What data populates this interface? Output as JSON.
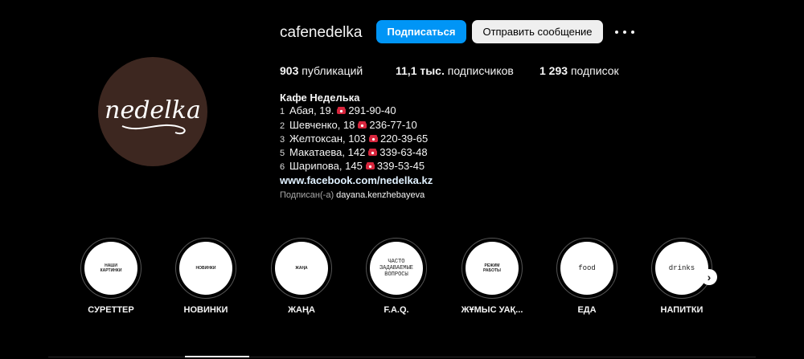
{
  "profile": {
    "username": "cafenedelka",
    "follow_label": "Подписаться",
    "message_label": "Отправить сообщение",
    "more_icon": "more-horizontal-icon",
    "avatar_text": "nedelka",
    "avatar_bg": "#3d2720"
  },
  "stats": {
    "posts_count": "903",
    "posts_label": "публикаций",
    "followers_count": "11,1 тыс.",
    "followers_label": "подписчиков",
    "following_count": "1 293",
    "following_label": "подписок"
  },
  "bio": {
    "name": "Кафе Неделька",
    "lines": [
      {
        "num": "1",
        "address": "Абая, 19.",
        "phone": "291-90-40"
      },
      {
        "num": "2",
        "address": "Шевченко, 18",
        "phone": "236-77-10"
      },
      {
        "num": "3",
        "address": "Желтоксан, 103",
        "phone": "220-39-65"
      },
      {
        "num": "5",
        "address": "Макатаева, 142",
        "phone": "339-63-48"
      },
      {
        "num": "6",
        "address": "Шарипова, 145",
        "phone": "339-53-45"
      }
    ],
    "phone_icon": "telephone-icon",
    "link": "www.facebook.com/nedelka.kz",
    "followed_by_prefix": "Подписан(-а)",
    "followed_by_user": "dayana.kenzhebayeva"
  },
  "highlights": [
    {
      "cover": "НАШИ\nКАРТИНКИ",
      "label": "СУРЕТТЕР"
    },
    {
      "cover": "НОВИНКИ",
      "label": "НОВИНКИ"
    },
    {
      "cover": "ЖАҢА",
      "label": "ЖАҢА"
    },
    {
      "cover": "ЧАСТО\nЗАДАВАЕМЫЕ\nВОПРОСЫ",
      "label": "F.A.Q."
    },
    {
      "cover": "РЕЖИМ\nРАБОТЫ",
      "label": "ЖҰМЫС УАҚ..."
    },
    {
      "cover": "food",
      "label": "ЕДА"
    },
    {
      "cover": "drinks",
      "label": "НАПИТКИ"
    }
  ],
  "next_icon": "chevron-right-icon",
  "colors": {
    "accent": "#0095f6",
    "background": "#000000"
  }
}
